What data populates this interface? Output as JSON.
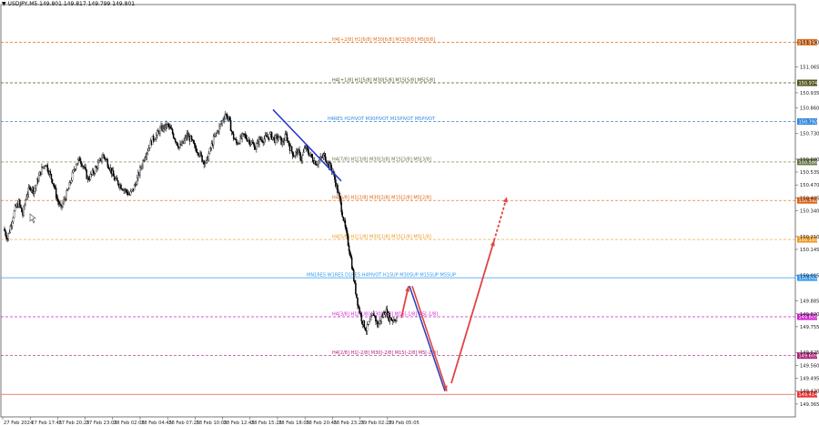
{
  "header": {
    "caret": "▼",
    "symbol": "USDJPY,M5",
    "ohlc": "149.801 149.817 149.799 149.801"
  },
  "colors": {
    "bg": "#ffffff",
    "candle": "#000000",
    "grid": "#c8c8c8",
    "trendline": "#2233cc",
    "arrow": "#e04444"
  },
  "chart_data": {
    "type": "candlestick",
    "ylim": [
      149.3,
      151.38
    ],
    "yticks": [
      "151.190",
      "151.065",
      "150.935",
      "150.860",
      "150.730",
      "150.600",
      "150.535",
      "150.470",
      "150.405",
      "150.340",
      "150.210",
      "150.145",
      "150.015",
      "149.885",
      "149.820",
      "149.755",
      "149.625",
      "149.560",
      "149.495",
      "149.430",
      "149.365"
    ],
    "xticks": [
      "27 Feb 2024",
      "27 Feb 17:45",
      "27 Feb 20:25",
      "27 Feb 23:05",
      "28 Feb 02:05",
      "28 Feb 04:45",
      "28 Feb 07:25",
      "28 Feb 10:05",
      "28 Feb 12:45",
      "28 Feb 15:25",
      "28 Feb 18:05",
      "28 Feb 20:45",
      "28 Feb 23:25",
      "29 Feb 02:25",
      "29 Feb 05:05"
    ],
    "close_series": [
      150.25,
      150.2,
      150.28,
      150.35,
      150.38,
      150.32,
      150.42,
      150.46,
      150.44,
      150.5,
      150.55,
      150.58,
      150.53,
      150.48,
      150.4,
      150.35,
      150.4,
      150.45,
      150.52,
      150.58,
      150.6,
      150.56,
      150.5,
      150.52,
      150.55,
      150.58,
      150.62,
      150.59,
      150.55,
      150.5,
      150.48,
      150.46,
      150.44,
      150.42,
      150.45,
      150.5,
      150.56,
      150.62,
      150.66,
      150.7,
      150.72,
      150.75,
      150.76,
      150.77,
      150.74,
      150.7,
      150.66,
      150.68,
      150.72,
      150.7,
      150.66,
      150.64,
      150.6,
      150.58,
      150.64,
      150.7,
      150.74,
      150.78,
      150.83,
      150.8,
      150.72,
      150.68,
      150.7,
      150.72,
      150.7,
      150.68,
      150.66,
      150.7,
      150.7,
      150.71,
      150.72,
      150.7,
      150.71,
      150.68,
      150.72,
      150.66,
      150.62,
      150.64,
      150.6,
      150.66,
      150.63,
      150.6,
      150.58,
      150.6,
      150.62,
      150.58,
      150.55,
      150.48,
      150.4,
      150.3,
      150.2,
      150.1,
      149.96,
      149.85,
      149.78,
      149.74,
      149.78,
      149.82,
      149.76,
      149.8,
      149.84,
      149.8,
      149.79,
      149.8
    ],
    "levels": [
      {
        "price": 151.19,
        "label": "H4[+2/8] H1[6/8] M30[6/8] M15[8/8] M5[8/8]",
        "tag": "151.190",
        "color": "#e07020",
        "style": "dashed"
      },
      {
        "price": 150.985,
        "label": "H4[+1/8] H1[5/8] M30[5/8] M15[5/8] M5[5/8]",
        "tag": "150.974",
        "color": "#555522",
        "style": "dashed"
      },
      {
        "price": 150.79,
        "label": "H4RES H1PIVOT M30PIVOT M15PIVOT M5PIVOT",
        "tag": "150.792",
        "color": "#3388dd",
        "style": "dashed"
      },
      {
        "price": 150.586,
        "label": "H4[7/8] H1[3/8] M30[3/8] M15[3/8] M5[3/8]",
        "tag": "150.586",
        "color": "#667744",
        "style": "dashed"
      },
      {
        "price": 150.392,
        "label": "H4[6/8] H1[2/8] M30[2/8] M15[2/8] M5[2/8]",
        "tag": "150.392",
        "color": "#e06010",
        "style": "dashed"
      },
      {
        "price": 150.195,
        "label": "H4[5/8] H1[1/8] M30[1/8] M15[1/8] M5[1/8]",
        "tag": "150.195",
        "color": "#ee9922",
        "style": "dashed"
      },
      {
        "price": 150.002,
        "label": "MN1RES W1RES D1RES H4PIVOT H1SUP M30SUP M15SUP M5SUP",
        "tag": "150.002",
        "color": "#3399ee",
        "style": "solid"
      },
      {
        "price": 149.805,
        "label": "H4[3/8] H1[-1/8] M30[-1/8] M15[-1/8] M5[-1/8]",
        "tag": "149.805",
        "color": "#cc22cc",
        "style": "dashed"
      },
      {
        "price": 149.609,
        "label": "H4[2/8] H1[-2/8] M30[-2/8] M15[-2/8] M5[-2/8]",
        "tag": "149.609",
        "color": "#aa2277",
        "style": "dashed"
      },
      {
        "price": 149.414,
        "label": "",
        "tag": "149.414",
        "color": "#ee3333",
        "style": "solid"
      }
    ],
    "trendline": [
      [
        150.85
      ],
      [
        150.49
      ]
    ],
    "forecast": {
      "description_points": [
        149.8,
        149.96,
        149.43,
        149.47,
        150.19,
        150.41
      ],
      "dashed_tail": true
    }
  }
}
